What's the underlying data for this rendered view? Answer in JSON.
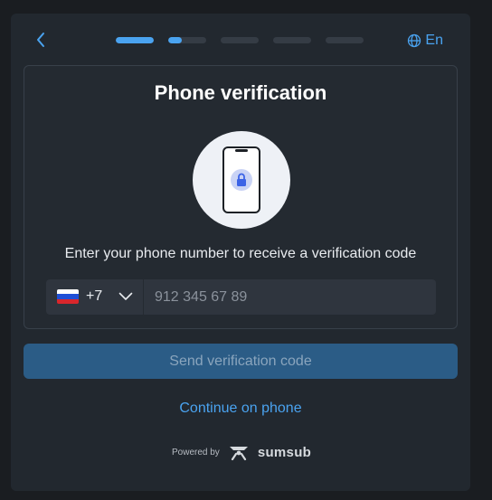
{
  "header": {
    "back_icon": "chevron-left-icon",
    "steps": [
      {
        "progress": 1.0
      },
      {
        "progress": 0.35
      },
      {
        "progress": 0.0
      },
      {
        "progress": 0.0
      },
      {
        "progress": 0.0
      }
    ],
    "language": "En",
    "language_icon": "globe-icon"
  },
  "card": {
    "title": "Phone verification",
    "illustration_icon": "phone-lock-icon",
    "subtitle": "Enter your phone number to receive a verification code",
    "phone": {
      "country_flag": "ru-flag-icon",
      "country_code": "+7",
      "dropdown_icon": "chevron-down-icon",
      "placeholder": "912 345 67 89",
      "value": ""
    }
  },
  "actions": {
    "send_label": "Send verification code",
    "continue_label": "Continue on phone"
  },
  "footer": {
    "powered_by": "Powered by",
    "brand": "sumsub",
    "brand_icon": "sumsub-logo-icon"
  },
  "colors": {
    "background": "#1a1d21",
    "panel": "#22282f",
    "accent": "#4aa3f0",
    "button_disabled": "#2b5c86",
    "text": "#ffffff"
  }
}
